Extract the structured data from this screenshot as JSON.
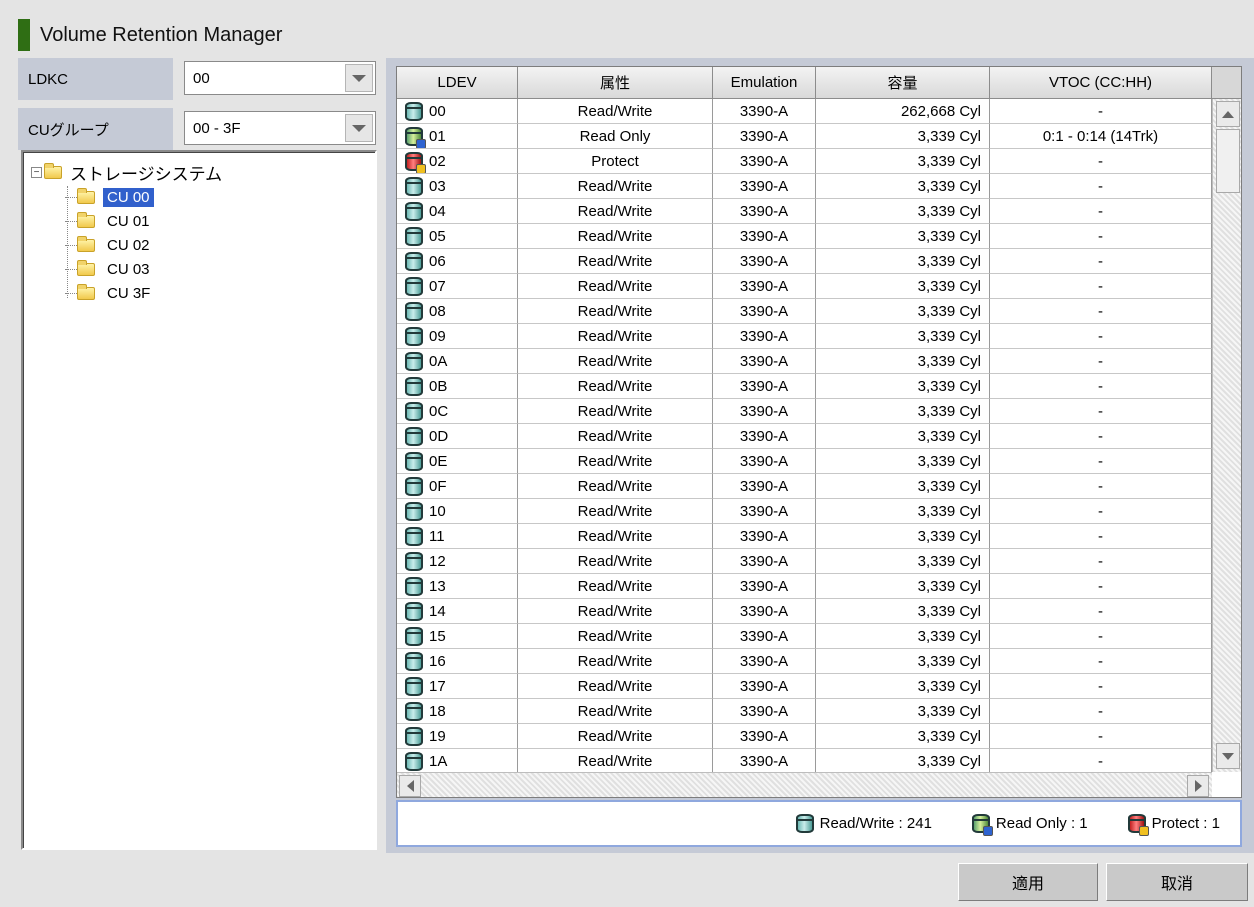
{
  "window": {
    "title": "Volume Retention Manager"
  },
  "filters": {
    "ldkc": {
      "label": "LDKC",
      "value": "00"
    },
    "cu_group": {
      "label": "CUグループ",
      "value": "00 - 3F"
    }
  },
  "tree": {
    "root": "ストレージシステム",
    "children": [
      "CU 00",
      "CU 01",
      "CU 02",
      "CU 03",
      "CU 3F"
    ],
    "selected": "CU 00"
  },
  "table": {
    "columns": [
      "LDEV",
      "属性",
      "Emulation",
      "容量",
      "VTOC (CC:HH)"
    ],
    "rows": [
      {
        "ldev": "00",
        "attr": "Read/Write",
        "emulation": "3390-A",
        "capacity": "262,668 Cyl",
        "vtoc": "-",
        "type": "rw"
      },
      {
        "ldev": "01",
        "attr": "Read Only",
        "emulation": "3390-A",
        "capacity": "3,339 Cyl",
        "vtoc": "0:1 - 0:14 (14Trk)",
        "type": "ro"
      },
      {
        "ldev": "02",
        "attr": "Protect",
        "emulation": "3390-A",
        "capacity": "3,339 Cyl",
        "vtoc": "-",
        "type": "pr"
      },
      {
        "ldev": "03",
        "attr": "Read/Write",
        "emulation": "3390-A",
        "capacity": "3,339 Cyl",
        "vtoc": "-",
        "type": "rw"
      },
      {
        "ldev": "04",
        "attr": "Read/Write",
        "emulation": "3390-A",
        "capacity": "3,339 Cyl",
        "vtoc": "-",
        "type": "rw"
      },
      {
        "ldev": "05",
        "attr": "Read/Write",
        "emulation": "3390-A",
        "capacity": "3,339 Cyl",
        "vtoc": "-",
        "type": "rw"
      },
      {
        "ldev": "06",
        "attr": "Read/Write",
        "emulation": "3390-A",
        "capacity": "3,339 Cyl",
        "vtoc": "-",
        "type": "rw"
      },
      {
        "ldev": "07",
        "attr": "Read/Write",
        "emulation": "3390-A",
        "capacity": "3,339 Cyl",
        "vtoc": "-",
        "type": "rw"
      },
      {
        "ldev": "08",
        "attr": "Read/Write",
        "emulation": "3390-A",
        "capacity": "3,339 Cyl",
        "vtoc": "-",
        "type": "rw"
      },
      {
        "ldev": "09",
        "attr": "Read/Write",
        "emulation": "3390-A",
        "capacity": "3,339 Cyl",
        "vtoc": "-",
        "type": "rw"
      },
      {
        "ldev": "0A",
        "attr": "Read/Write",
        "emulation": "3390-A",
        "capacity": "3,339 Cyl",
        "vtoc": "-",
        "type": "rw"
      },
      {
        "ldev": "0B",
        "attr": "Read/Write",
        "emulation": "3390-A",
        "capacity": "3,339 Cyl",
        "vtoc": "-",
        "type": "rw"
      },
      {
        "ldev": "0C",
        "attr": "Read/Write",
        "emulation": "3390-A",
        "capacity": "3,339 Cyl",
        "vtoc": "-",
        "type": "rw"
      },
      {
        "ldev": "0D",
        "attr": "Read/Write",
        "emulation": "3390-A",
        "capacity": "3,339 Cyl",
        "vtoc": "-",
        "type": "rw"
      },
      {
        "ldev": "0E",
        "attr": "Read/Write",
        "emulation": "3390-A",
        "capacity": "3,339 Cyl",
        "vtoc": "-",
        "type": "rw"
      },
      {
        "ldev": "0F",
        "attr": "Read/Write",
        "emulation": "3390-A",
        "capacity": "3,339 Cyl",
        "vtoc": "-",
        "type": "rw"
      },
      {
        "ldev": "10",
        "attr": "Read/Write",
        "emulation": "3390-A",
        "capacity": "3,339 Cyl",
        "vtoc": "-",
        "type": "rw"
      },
      {
        "ldev": "11",
        "attr": "Read/Write",
        "emulation": "3390-A",
        "capacity": "3,339 Cyl",
        "vtoc": "-",
        "type": "rw"
      },
      {
        "ldev": "12",
        "attr": "Read/Write",
        "emulation": "3390-A",
        "capacity": "3,339 Cyl",
        "vtoc": "-",
        "type": "rw"
      },
      {
        "ldev": "13",
        "attr": "Read/Write",
        "emulation": "3390-A",
        "capacity": "3,339 Cyl",
        "vtoc": "-",
        "type": "rw"
      },
      {
        "ldev": "14",
        "attr": "Read/Write",
        "emulation": "3390-A",
        "capacity": "3,339 Cyl",
        "vtoc": "-",
        "type": "rw"
      },
      {
        "ldev": "15",
        "attr": "Read/Write",
        "emulation": "3390-A",
        "capacity": "3,339 Cyl",
        "vtoc": "-",
        "type": "rw"
      },
      {
        "ldev": "16",
        "attr": "Read/Write",
        "emulation": "3390-A",
        "capacity": "3,339 Cyl",
        "vtoc": "-",
        "type": "rw"
      },
      {
        "ldev": "17",
        "attr": "Read/Write",
        "emulation": "3390-A",
        "capacity": "3,339 Cyl",
        "vtoc": "-",
        "type": "rw"
      },
      {
        "ldev": "18",
        "attr": "Read/Write",
        "emulation": "3390-A",
        "capacity": "3,339 Cyl",
        "vtoc": "-",
        "type": "rw"
      },
      {
        "ldev": "19",
        "attr": "Read/Write",
        "emulation": "3390-A",
        "capacity": "3,339 Cyl",
        "vtoc": "-",
        "type": "rw"
      },
      {
        "ldev": "1A",
        "attr": "Read/Write",
        "emulation": "3390-A",
        "capacity": "3,339 Cyl",
        "vtoc": "-",
        "type": "rw"
      }
    ]
  },
  "legend": {
    "read_write": "Read/Write : 241",
    "read_only": "Read Only : 1",
    "protect": "Protect : 1"
  },
  "buttons": {
    "apply": "適用",
    "cancel": "取消"
  },
  "colors": {
    "title_mark": "#2f6e14",
    "selection": "#3160cc",
    "panel": "#c5cad6",
    "legend_border": "#8fa8de"
  }
}
